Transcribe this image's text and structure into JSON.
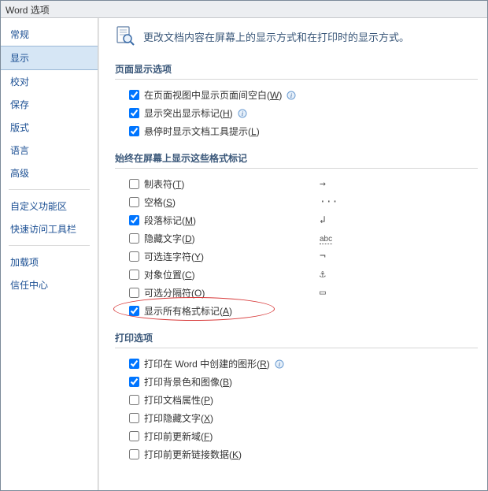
{
  "title": "Word 选项",
  "sidebar": {
    "items": [
      {
        "label": "常规"
      },
      {
        "label": "显示"
      },
      {
        "label": "校对"
      },
      {
        "label": "保存"
      },
      {
        "label": "版式"
      },
      {
        "label": "语言"
      },
      {
        "label": "高级"
      },
      {
        "label": "自定义功能区"
      },
      {
        "label": "快速访问工具栏"
      },
      {
        "label": "加载项"
      },
      {
        "label": "信任中心"
      }
    ],
    "selected_index": 1
  },
  "main": {
    "header": "更改文档内容在屏幕上的显示方式和在打印时的显示方式。",
    "sections": [
      {
        "title": "页面显示选项",
        "options": [
          {
            "label": "在页面视图中显示页面间空白",
            "accel": "W",
            "checked": true,
            "info": true
          },
          {
            "label": "显示突出显示标记",
            "accel": "H",
            "checked": true,
            "info": true
          },
          {
            "label": "悬停时显示文档工具提示",
            "accel": "L",
            "checked": true
          }
        ]
      },
      {
        "title": "始终在屏幕上显示这些格式标记",
        "options": [
          {
            "label": "制表符",
            "accel": "T",
            "checked": false,
            "symbol": "→"
          },
          {
            "label": "空格",
            "accel": "S",
            "checked": false,
            "symbol": "···"
          },
          {
            "label": "段落标记",
            "accel": "M",
            "checked": true,
            "symbol": "↲"
          },
          {
            "label": "隐藏文字",
            "accel": "D",
            "checked": false,
            "symbol": "abc"
          },
          {
            "label": "可选连字符",
            "accel": "Y",
            "checked": false,
            "symbol": "¬"
          },
          {
            "label": "对象位置",
            "accel": "C",
            "checked": false,
            "symbol": "⚓"
          },
          {
            "label": "可选分隔符",
            "accel": "O",
            "checked": false,
            "symbol": "▭"
          },
          {
            "label": "显示所有格式标记",
            "accel": "A",
            "checked": true,
            "highlight": true
          }
        ]
      },
      {
        "title": "打印选项",
        "options": [
          {
            "label": "打印在 Word 中创建的图形",
            "accel": "R",
            "checked": true,
            "info": true
          },
          {
            "label": "打印背景色和图像",
            "accel": "B",
            "checked": true
          },
          {
            "label": "打印文档属性",
            "accel": "P",
            "checked": false
          },
          {
            "label": "打印隐藏文字",
            "accel": "X",
            "checked": false
          },
          {
            "label": "打印前更新域",
            "accel": "F",
            "checked": false
          },
          {
            "label": "打印前更新链接数据",
            "accel": "K",
            "checked": false
          }
        ]
      }
    ]
  }
}
